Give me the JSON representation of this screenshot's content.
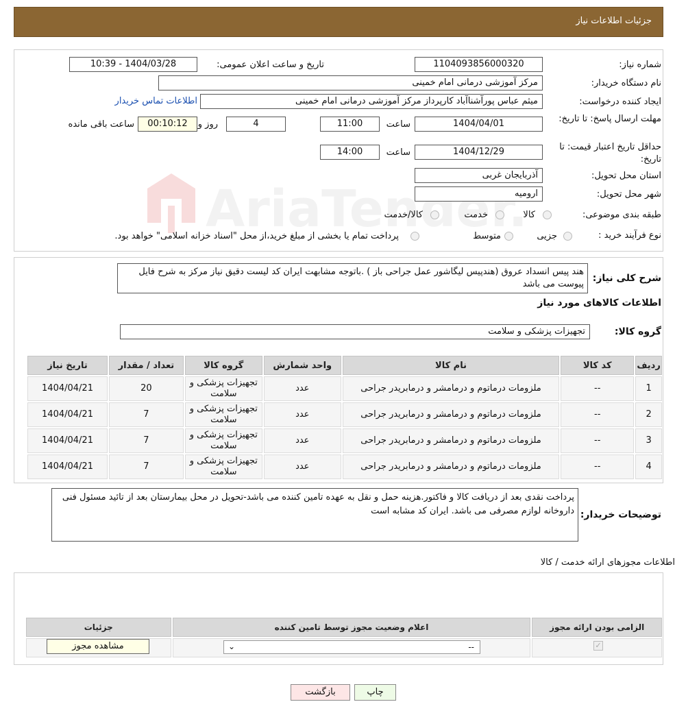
{
  "page": {
    "title": "جزئیات اطلاعات نیاز"
  },
  "form": {
    "need_number_label": "شماره نیاز:",
    "need_number": "1104093856000320",
    "announce_label": "تاریخ و ساعت اعلان عمومی:",
    "announce_value": "1404/03/28 - 10:39",
    "buyer_org_label": "نام دستگاه خریدار:",
    "buyer_org": "مرکز آموزشی درمانی امام خمینی",
    "creator_label": "ایجاد کننده درخواست:",
    "creator": "میثم عباس پورآشناآباد کارپرداز مرکز آموزشی درمانی امام خمینی",
    "contact_link": "اطلاعات تماس خریدار",
    "deadline_label": "مهلت ارسال پاسخ: تا تاریخ:",
    "deadline_date": "1404/04/01",
    "time_label": "ساعت",
    "deadline_time": "11:00",
    "days_value": "4",
    "days_label": "روز و",
    "remaining_value": "00:10:12",
    "remaining_label": "ساعت باقی مانده",
    "validity_label": "حداقل تاریخ اعتبار قیمت: تا تاریخ:",
    "validity_date": "1404/12/29",
    "validity_time": "14:00",
    "province_label": "استان محل تحویل:",
    "province": "آذربایجان غربی",
    "city_label": "شهر محل تحویل:",
    "city": "ارومیه",
    "category_label": "طبقه بندی موضوعی:",
    "category_options": [
      "کالا",
      "خدمت",
      "کالا/خدمت"
    ],
    "process_label": "نوع فرآیند خرید :",
    "process_options": [
      "جزیی",
      "متوسط"
    ],
    "process_note": "پرداخت تمام یا بخشی از مبلغ خرید،از محل \"اسناد خزانه اسلامی\" خواهد بود."
  },
  "watermark": {
    "text": "AriaTender.neT"
  },
  "summary": {
    "label": "شرح کلی نیاز:",
    "text": "هند پیس انسداد عروق (هندپیس لیگاشور عمل جراحی باز )  .باتوجه مشابهت ایران کد لیست دقیق نیاز مرکز به شرح فایل پیوست می باشد",
    "goods_heading": "اطلاعات کالاهای مورد نیاز",
    "group_label": "گروه کالا:",
    "group_value": "تجهیزات پزشکی و سلامت"
  },
  "items_table": {
    "headers": [
      "ردیف",
      "کد کالا",
      "نام کالا",
      "واحد شمارش",
      "گروه کالا",
      "تعداد / مقدار",
      "تاریخ نیاز"
    ],
    "rows": [
      [
        "1",
        "--",
        "ملزومات درماتوم و درمامشر و درمابریدر جراحی",
        "عدد",
        "تجهیزات پزشکی و سلامت",
        "20",
        "1404/04/21"
      ],
      [
        "2",
        "--",
        "ملزومات درماتوم و درمامشر و درمابریدر جراحی",
        "عدد",
        "تجهیزات پزشکی و سلامت",
        "7",
        "1404/04/21"
      ],
      [
        "3",
        "--",
        "ملزومات درماتوم و درمامشر و درمابریدر جراحی",
        "عدد",
        "تجهیزات پزشکی و سلامت",
        "7",
        "1404/04/21"
      ],
      [
        "4",
        "--",
        "ملزومات درماتوم و درمامشر و درمابریدر جراحی",
        "عدد",
        "تجهیزات پزشکی و سلامت",
        "7",
        "1404/04/21"
      ]
    ]
  },
  "buyer_notes": {
    "label": "توضیحات خریدار:",
    "text": "پرداخت نقدی بعد از دریافت کالا و فاکتور.هزینه حمل و نقل به عهده تامین کننده می باشد-تحویل در محل بیمارستان بعد از تائید مسئول فنی داروخانه لوازم مصرفی می باشد. ایران کد مشابه است"
  },
  "permits": {
    "heading": "اطلاعات مجوزهای ارائه خدمت / کالا",
    "headers": [
      "الزامی بودن ارائه مجوز",
      "اعلام وضعیت مجوز توسط تامین کننده",
      "جزئیات"
    ],
    "select_value": "--",
    "view_button": "مشاهده مجوز"
  },
  "actions": {
    "print": "چاپ",
    "back": "بازگشت"
  },
  "colors": {
    "header_bg": "#8b6633",
    "back_btn": "#fde6e6",
    "print_btn": "#eefbe6"
  }
}
